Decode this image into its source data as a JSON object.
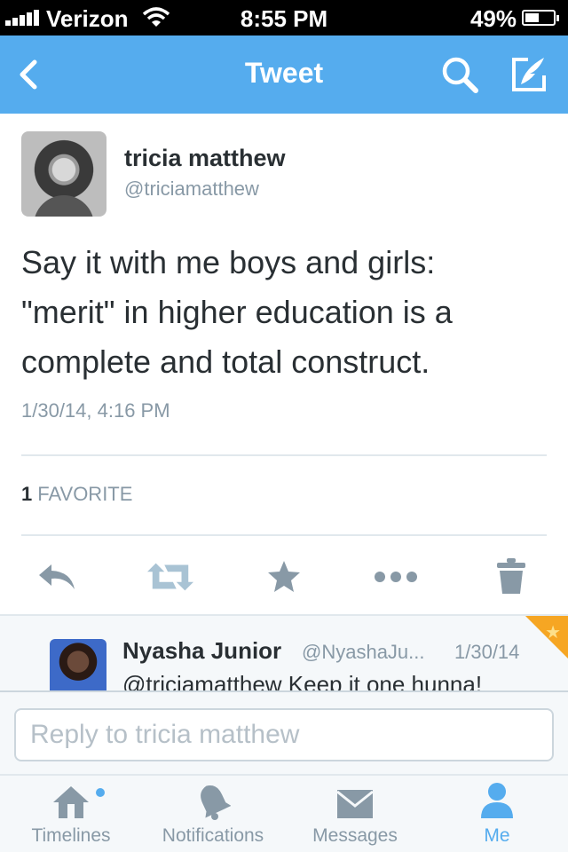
{
  "status_bar": {
    "carrier": "Verizon",
    "time": "8:55 PM",
    "battery": "49%",
    "battery_level": 0.49
  },
  "nav": {
    "title": "Tweet",
    "back_icon": "chevron-left-icon",
    "search_icon": "search-icon",
    "compose_icon": "compose-icon"
  },
  "tweet": {
    "author_name": "tricia matthew",
    "author_handle": "@triciamatthew",
    "lines": [
      "Say it with me boys and girls:",
      "\"merit\" in higher education is a",
      "complete and total construct."
    ],
    "date": "1/30/14, 4:16 PM",
    "favorites_count": "1",
    "favorites_label": "FAVORITE"
  },
  "actions": [
    "reply-icon",
    "retweet-icon",
    "favorite-icon",
    "more-icon",
    "delete-icon"
  ],
  "reply": {
    "name": "Nyasha Junior",
    "handle": "@NyashaJu...",
    "date": "1/30/14",
    "text": "@triciamatthew Keep it one hunna!"
  },
  "composer": {
    "placeholder": "Reply to tricia matthew"
  },
  "tabs": [
    {
      "label": "Timelines",
      "icon": "home-icon",
      "active": false,
      "has_badge": true
    },
    {
      "label": "Notifications",
      "icon": "bell-icon",
      "active": false,
      "has_badge": false
    },
    {
      "label": "Messages",
      "icon": "envelope-icon",
      "active": false,
      "has_badge": false
    },
    {
      "label": "Me",
      "icon": "person-icon",
      "active": true,
      "has_badge": false
    }
  ],
  "colors": {
    "accent": "#55acee",
    "muted": "#8899a6",
    "text": "#292f33",
    "favorite_corner": "#f6a623"
  }
}
